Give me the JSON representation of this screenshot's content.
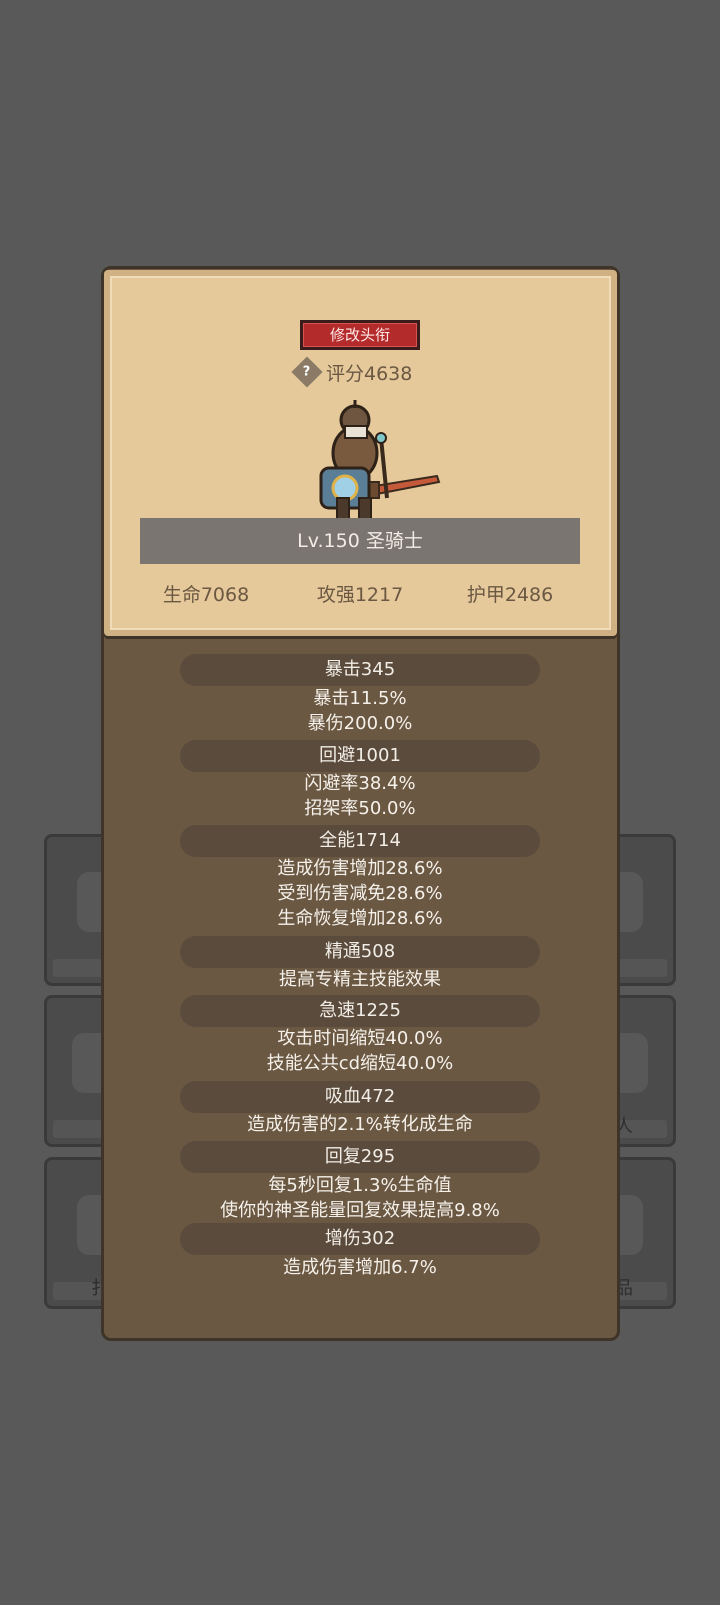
{
  "header": {
    "title_button": "修改头衔",
    "score": "评分4638"
  },
  "hero": {
    "level_name": "Lv.150 圣骑士",
    "stats": [
      "生命7068",
      "攻强1217",
      "护甲2486"
    ]
  },
  "attributes": [
    {
      "header": "暴击345",
      "lines": [
        "暴击11.5%",
        "暴伤200.0%"
      ]
    },
    {
      "header": "回避1001",
      "lines": [
        "闪避率38.4%",
        "招架率50.0%"
      ]
    },
    {
      "header": "全能1714",
      "lines": [
        "造成伤害增加28.6%",
        "受到伤害减免28.6%",
        "生命恢复增加28.6%"
      ]
    },
    {
      "header": "精通508",
      "lines": [
        "提高专精主技能效果"
      ]
    },
    {
      "header": "急速1225",
      "lines": [
        "攻击时间缩短40.0%",
        "技能公共cd缩短40.0%"
      ]
    },
    {
      "header": "吸血472",
      "lines": [
        "造成伤害的2.1%转化成生命"
      ]
    },
    {
      "header": "回复295",
      "lines": [
        "每5秒回复1.3%生命值",
        "使你的神圣能量回复效果提高9.8%"
      ]
    },
    {
      "header": "增伤302",
      "lines": [
        "造成伤害增加6.7%"
      ]
    }
  ],
  "background_fragments": [
    "人",
    "扌",
    "品"
  ],
  "colors": {
    "background": "#595959",
    "panel": "#6b5843",
    "parchment": "#e6c99b",
    "title_button": "#b42b2b",
    "header_pill": "#5a4b3c"
  }
}
